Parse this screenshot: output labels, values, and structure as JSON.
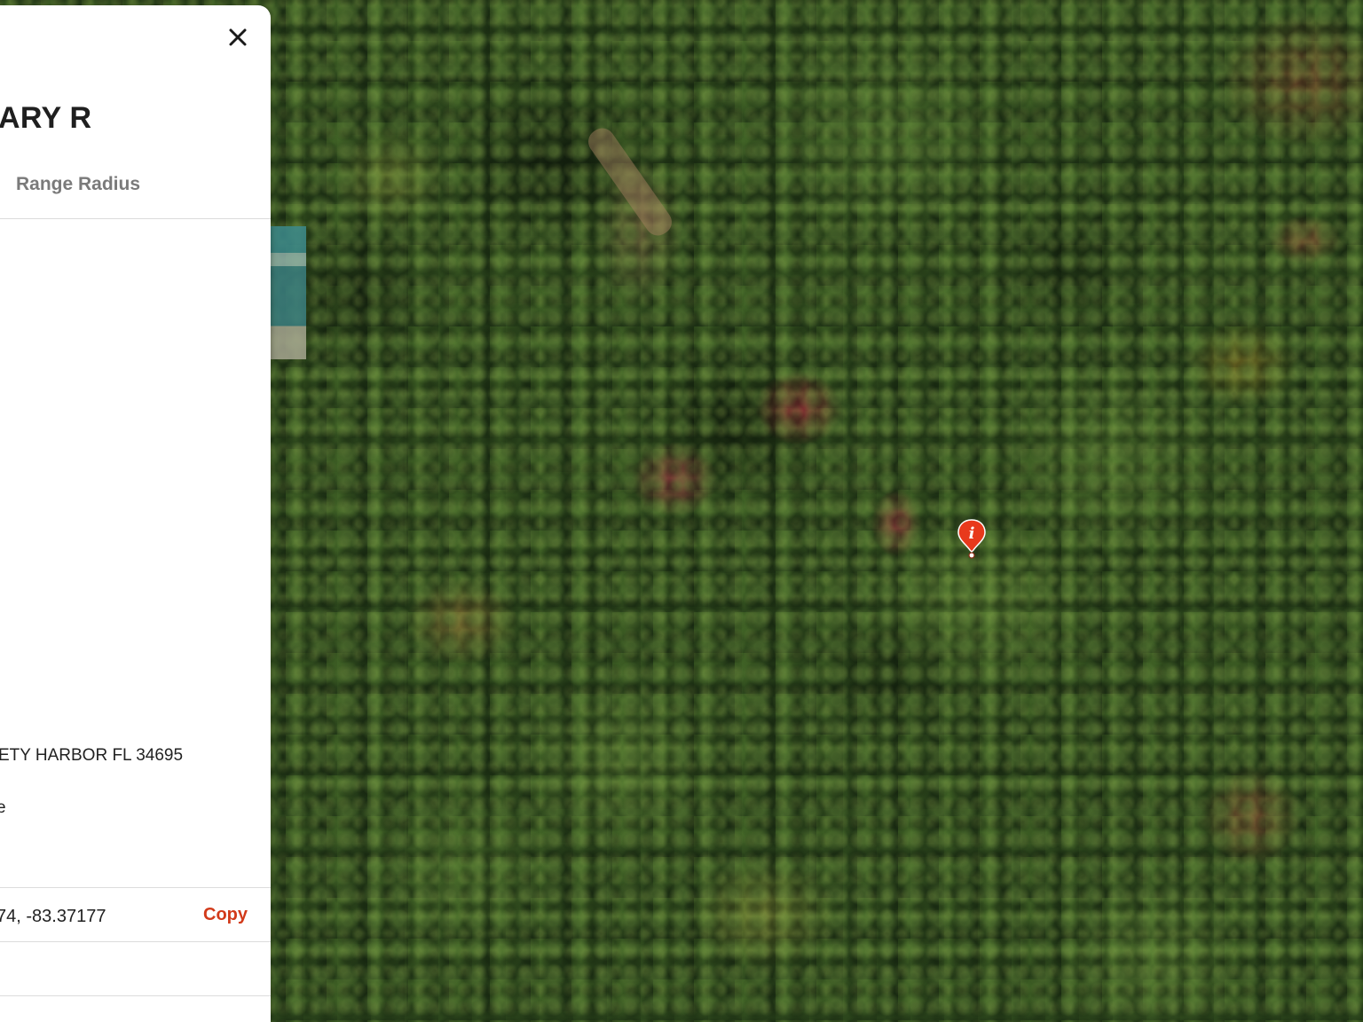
{
  "panel": {
    "title": "ARY R",
    "tab_label": "Range Radius",
    "address": "ETY HARBOR FL 34695",
    "fragment": "e",
    "coordinates": "74, -83.37177",
    "copy_label": "Copy",
    "close_icon": "close-icon"
  },
  "map": {
    "imagery": "aerial satellite imagery of forest canopy",
    "marker_icon": "info-marker-icon",
    "marker_glyph": "i",
    "marker_color": "#e8391c"
  },
  "colors": {
    "accent": "#d23a1a",
    "tab_text": "#7a7a7a",
    "title_text": "#1f1f1f"
  }
}
